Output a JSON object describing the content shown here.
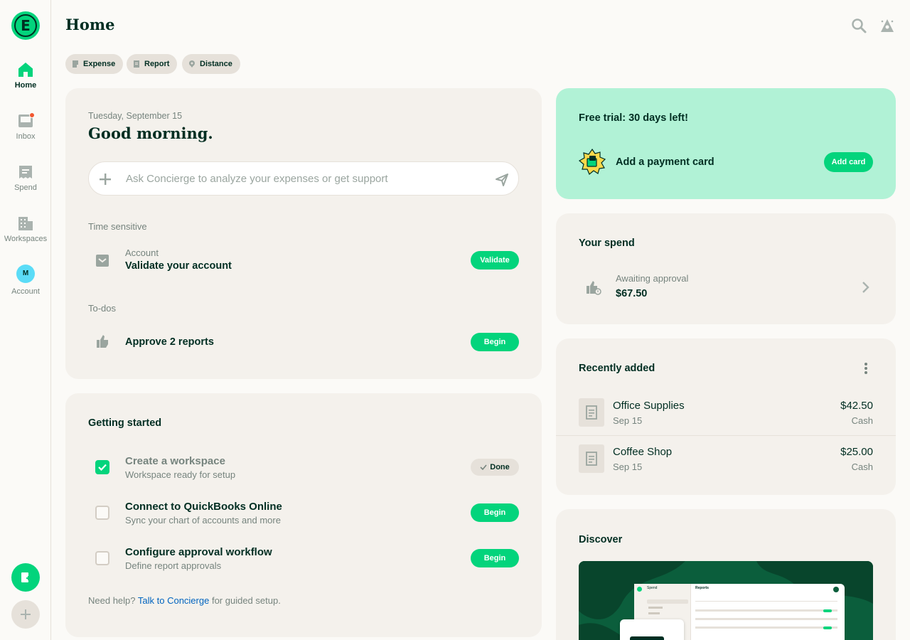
{
  "sidebar": {
    "logo_letter": "E",
    "items": [
      {
        "label": "Home",
        "icon": "home-icon",
        "active": true
      },
      {
        "label": "Inbox",
        "icon": "inbox-icon",
        "badge": true
      },
      {
        "label": "Spend",
        "icon": "receipt-icon"
      },
      {
        "label": "Workspaces",
        "icon": "building-icon"
      },
      {
        "label": "Account",
        "avatar_initial": "M"
      }
    ]
  },
  "header": {
    "title": "Home"
  },
  "quick_actions": [
    {
      "label": "Expense",
      "icon": "expense-icon"
    },
    {
      "label": "Report",
      "icon": "report-icon"
    },
    {
      "label": "Distance",
      "icon": "location-icon"
    }
  ],
  "greeting_card": {
    "date": "Tuesday, September 15",
    "greeting": "Good morning.",
    "concierge_placeholder": "Ask Concierge to analyze your expenses or get support",
    "time_sensitive_label": "Time sensitive",
    "time_sensitive_item": {
      "kicker": "Account",
      "title": "Validate your account",
      "button": "Validate"
    },
    "todos_label": "To-dos",
    "todo_item": {
      "title": "Approve 2 reports",
      "button": "Begin"
    }
  },
  "getting_started": {
    "title": "Getting started",
    "tasks": [
      {
        "title": "Create a workspace",
        "subtitle": "Workspace ready for setup",
        "done": true,
        "button": "Done"
      },
      {
        "title": "Connect to QuickBooks Online",
        "subtitle": "Sync your chart of accounts and more",
        "done": false,
        "button": "Begin"
      },
      {
        "title": "Configure approval workflow",
        "subtitle": "Define report approvals",
        "done": false,
        "button": "Begin"
      }
    ],
    "help_prefix": "Need help?",
    "help_link": "Talk to Concierge",
    "help_suffix": "for guided setup."
  },
  "trial_card": {
    "title": "Free trial: 30 days left!",
    "payment_label": "Add a payment card",
    "button": "Add card"
  },
  "spend_card": {
    "title": "Your spend",
    "status": "Awaiting approval",
    "amount": "$67.50"
  },
  "recent_card": {
    "title": "Recently added",
    "items": [
      {
        "merchant": "Office Supplies",
        "date": "Sep 15",
        "amount": "$42.50",
        "type": "Cash"
      },
      {
        "merchant": "Coffee Shop",
        "date": "Sep 15",
        "amount": "$25.00",
        "type": "Cash"
      }
    ]
  },
  "discover_card": {
    "title": "Discover",
    "preview_heading": "Reports",
    "preview_nav_title": "Spend"
  },
  "colors": {
    "brand_green": "#03d47c",
    "dark_green": "#002e22",
    "trial_bg": "#b1f2d6",
    "link_blue": "#0164bf",
    "badge_red": "#f25730"
  }
}
